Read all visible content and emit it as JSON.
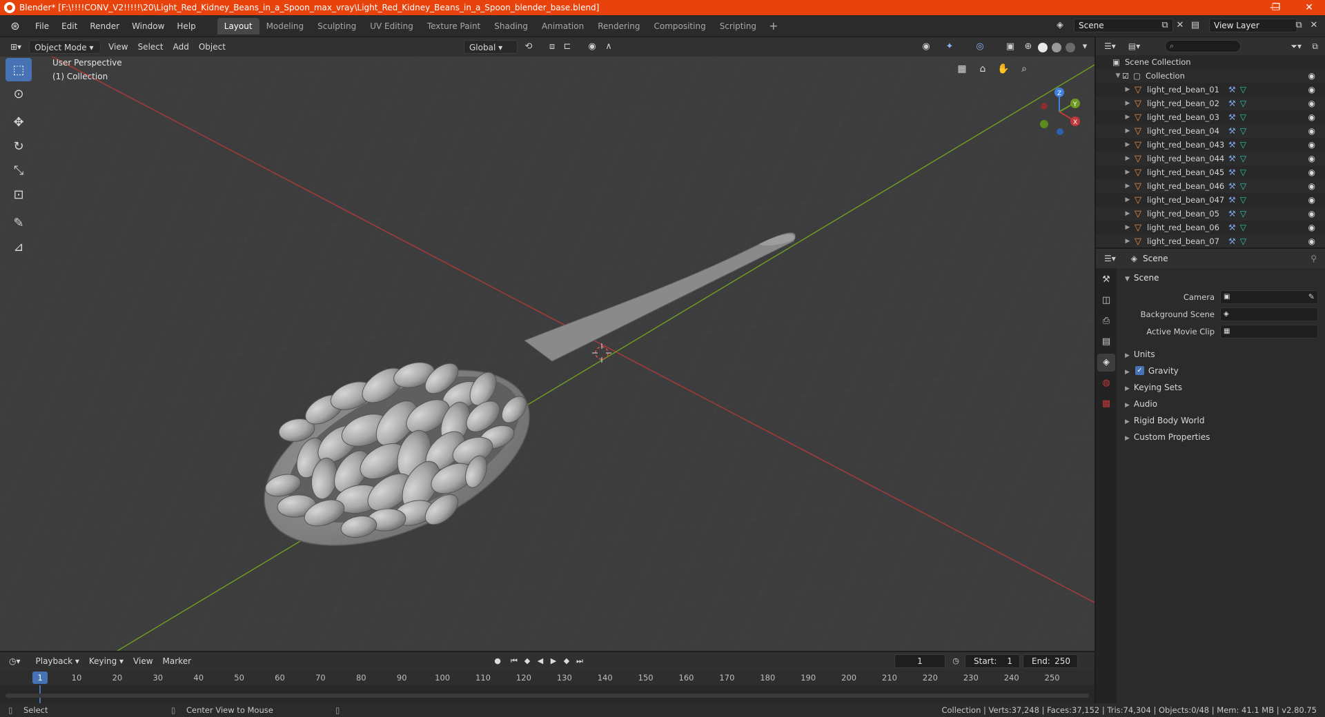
{
  "window": {
    "title": "Blender* [F:\\!!!!CONV_V2!!!!!\\20\\Light_Red_Kidney_Beans_in_a_Spoon_max_vray\\Light_Red_Kidney_Beans_in_a_Spoon_blender_base.blend]",
    "minimize": "—",
    "restore": "❐",
    "close": "✕"
  },
  "menubar": {
    "menus": [
      "File",
      "Edit",
      "Render",
      "Window",
      "Help"
    ],
    "workspaces": [
      "Layout",
      "Modeling",
      "Sculpting",
      "UV Editing",
      "Texture Paint",
      "Shading",
      "Animation",
      "Rendering",
      "Compositing",
      "Scripting"
    ],
    "active_workspace": "Layout",
    "scene_name": "Scene",
    "view_layer": "View Layer"
  },
  "viewport": {
    "mode": "Object Mode",
    "menus": [
      "View",
      "Select",
      "Add",
      "Object"
    ],
    "orientation": "Global",
    "overlay_line1": "User Perspective",
    "overlay_line2": "(1) Collection",
    "gizmo": {
      "x": "X",
      "y": "Y",
      "z": "Z"
    }
  },
  "outliner": {
    "root": "Scene Collection",
    "collection": "Collection",
    "objects": [
      "light_red_bean_01",
      "light_red_bean_02",
      "light_red_bean_03",
      "light_red_bean_04",
      "light_red_bean_043",
      "light_red_bean_044",
      "light_red_bean_045",
      "light_red_bean_046",
      "light_red_bean_047",
      "light_red_bean_05",
      "light_red_bean_06",
      "light_red_bean_07"
    ]
  },
  "properties": {
    "header": "Scene",
    "panel": "Scene",
    "camera_label": "Camera",
    "background_label": "Background Scene",
    "movie_clip_label": "Active Movie Clip",
    "subpanels": [
      "Units",
      "Gravity",
      "Keying Sets",
      "Audio",
      "Rigid Body World",
      "Custom Properties"
    ],
    "gravity_checked": true
  },
  "timeline": {
    "menus": [
      "Playback",
      "Keying",
      "View",
      "Marker"
    ],
    "current_frame": "1",
    "start_label": "Start:",
    "start": "1",
    "end_label": "End:",
    "end": "250",
    "ticks": [
      "1",
      "10",
      "20",
      "30",
      "40",
      "50",
      "60",
      "70",
      "80",
      "90",
      "100",
      "110",
      "120",
      "130",
      "140",
      "150",
      "160",
      "170",
      "180",
      "190",
      "200",
      "210",
      "220",
      "230",
      "240",
      "250"
    ]
  },
  "statusbar": {
    "left": "Select",
    "middle": "Center View to Mouse",
    "right": "Collection | Verts:37,248 | Faces:37,152 | Tris:74,304 | Objects:0/48 | Mem: 41.1 MB | v2.80.75"
  },
  "colors": {
    "title_bar": "#e8430c",
    "accent": "#4772b3",
    "x_axis": "#c0393c",
    "y_axis": "#6d9a23",
    "z_axis": "#3f7fe0",
    "object_icon": "#e8904a",
    "mesh_icon": "#22d2b0"
  }
}
